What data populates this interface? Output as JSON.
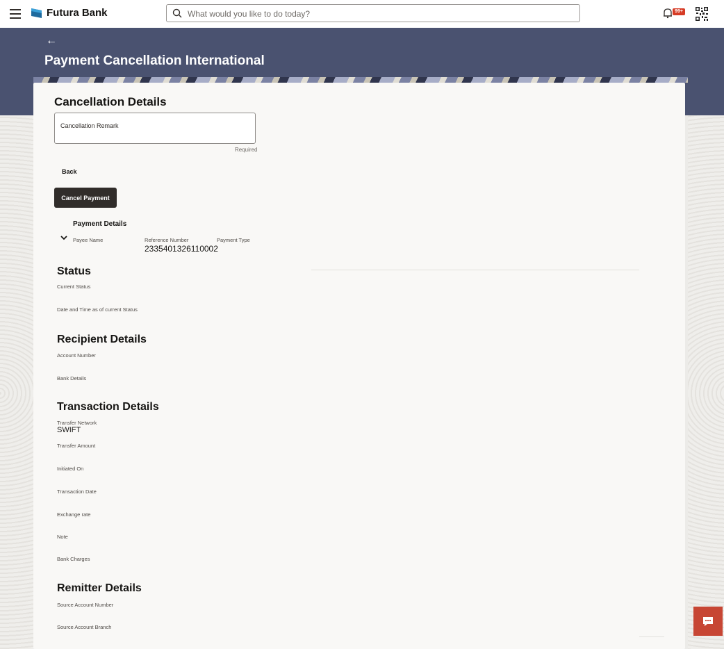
{
  "header": {
    "brand": "Futura Bank",
    "search_placeholder": "What would you like to do today?",
    "notification_badge": "99+"
  },
  "page": {
    "title": "Payment Cancellation International"
  },
  "cancellation": {
    "title": "Cancellation Details",
    "remark_label": "Cancellation Remark",
    "remark_value": "",
    "required_text": "Required",
    "back_label": "Back",
    "cancel_button": "Cancel Payment"
  },
  "payment_details": {
    "title": "Payment Details",
    "columns": [
      "Payee Name",
      "Reference Number",
      "Payment Type"
    ],
    "reference_number": "2335401326110002"
  },
  "status": {
    "title": "Status",
    "fields": [
      "Current Status",
      "Date and Time as of current Status"
    ]
  },
  "recipient": {
    "title": "Recipient Details",
    "fields": [
      "Account Number",
      "Bank Details"
    ]
  },
  "transaction": {
    "title": "Transaction Details",
    "transfer_network_label": "Transfer Network",
    "transfer_network_value": "SWIFT",
    "fields": [
      "Transfer Amount",
      "Initiated On",
      "Transaction Date",
      "Exchange rate",
      "Note",
      "Bank Charges"
    ]
  },
  "remitter": {
    "title": "Remitter Details",
    "fields": [
      "Source Account Number",
      "Source Account Branch"
    ]
  },
  "colors": {
    "band": "#4a5270",
    "button": "#312d2a",
    "chat": "#c74634",
    "badge": "#d63b25"
  },
  "icons": [
    "menu-icon",
    "bank-logo-icon",
    "search-icon",
    "bell-icon",
    "qr-code-icon",
    "back-arrow-icon",
    "chevron-down-icon",
    "chat-icon"
  ]
}
